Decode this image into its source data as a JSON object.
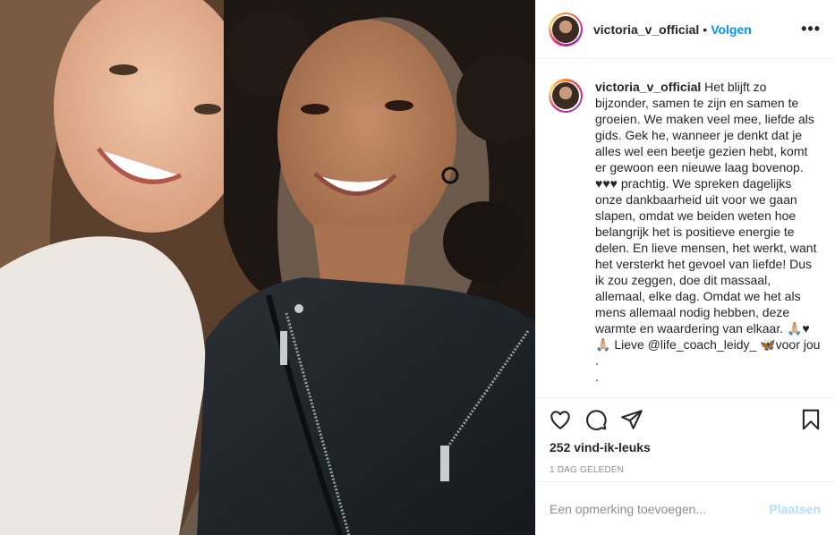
{
  "post": {
    "username": "victoria_v_official",
    "separator": "•",
    "follow_label": "Volgen",
    "more_icon": "•••",
    "caption_lines": [
      " Het blijft zo",
      "bijzonder, samen te zijn en samen te",
      "groeien. We maken veel mee, liefde als",
      "gids. Gek he, wanneer je denkt dat je",
      "alles wel een beetje gezien hebt, komt",
      "er gewoon een nieuwe laag bovenop.",
      "♥♥♥ prachtig. We spreken dagelijks",
      "onze dankbaarheid uit voor we gaan",
      "slapen, omdat we beiden weten hoe",
      "belangrijk het is positieve energie te",
      "delen. En lieve mensen, het werkt, want",
      "het versterkt het gevoel van liefde! Dus",
      "ik zou zeggen, doe dit massaal,",
      "allemaal, elke dag. Omdat we het als",
      "mens allemaal nodig hebben, deze",
      "warmte en waardering van elkaar. 🙏🏼♥",
      "🙏🏼 Lieve @life_coach_leidy_ 🦋voor jou",
      ".",
      "."
    ],
    "likes": "252 vind-ik-leuks",
    "time_ago": "1 DAG GELEDEN",
    "comment_placeholder": "Een opmerking toevoegen...",
    "post_button": "Plaatsen"
  },
  "icons": {
    "like": "heart-icon",
    "comment": "comment-icon",
    "share": "share-icon",
    "save": "bookmark-icon"
  },
  "colors": {
    "link_blue": "#0095f6",
    "post_button_disabled": "#b2dffc",
    "muted_text": "#8e8e8e",
    "border": "#efefef"
  }
}
